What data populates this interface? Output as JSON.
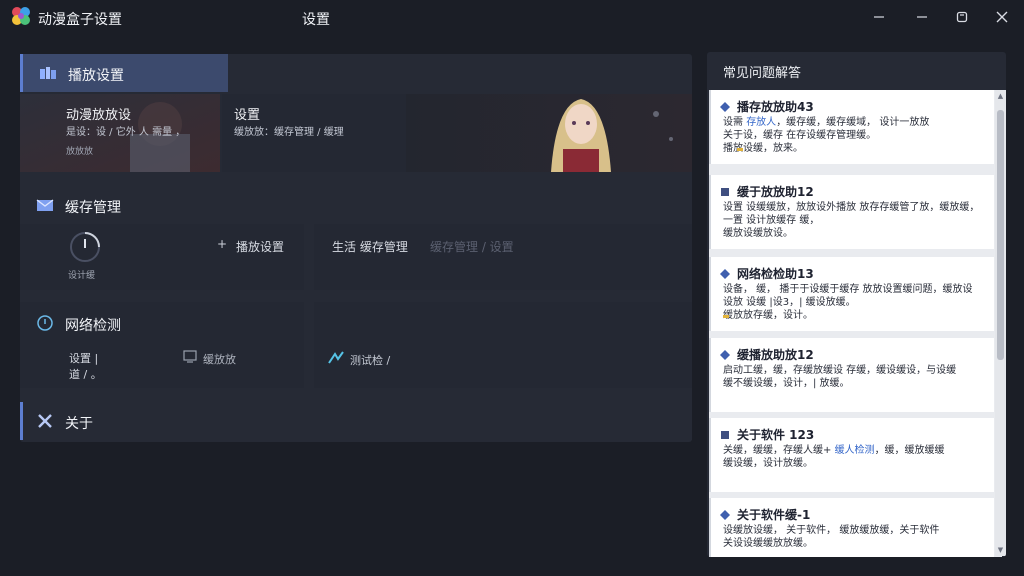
{
  "window": {
    "app_title": "动漫盒子设置",
    "center_title": "设置",
    "controls": {
      "minimize": "—",
      "restore": "—",
      "maximize": "☐",
      "close": "✕"
    }
  },
  "sections": {
    "playback": {
      "label": "播放设置",
      "cards": [
        {
          "title": "动漫放放设",
          "sub": "是设：设 / 它外 人 需量 ，",
          "tiny": "放放放"
        },
        {
          "title": "设置",
          "sub": "缓放放：缓存管理 / 缓理"
        }
      ]
    },
    "cache": {
      "label": "缓存管理",
      "gauge_label": "设计缓",
      "actions": [
        {
          "label": "播放设置"
        },
        {
          "label": "生活 缓存管理"
        },
        {
          "label": "缓存管理 / 设置"
        }
      ]
    },
    "network": {
      "label": "网络检测",
      "info": [
        "设置 |",
        "道 / 。"
      ],
      "actions": [
        {
          "label": "缓放放"
        },
        {
          "label": "测试检 /"
        }
      ]
    },
    "about": {
      "label": "关于"
    }
  },
  "faq": {
    "title": "常见问题解答",
    "items": [
      {
        "title": "播存放放助43",
        "lines": [
          "设需 存放人，缓存缓，缓存缓域， 设计一放放",
          "关于设，缓存 在存设缓存管理缓。",
          "播放设缓，放来。"
        ],
        "highlight": "存放人"
      },
      {
        "title": "缓于放放助12",
        "lines": [
          "设置 设缓缓放，放放设外播放 放存存缓管了放，缓放缓，",
          "一置 设计放缓存 缓，",
          "缓放设缓放设。"
        ],
        "highlight": "放放外"
      },
      {
        "title": "网络检检助13",
        "lines": [
          "设备， 缓， 播于于设缓于缓存 放放设置缓问题，缓放设",
          "设放 设缓 |设3，| 缓设放缓。",
          "缓放放存缓，设计。"
        ],
        "highlight": ""
      },
      {
        "title": "缓播放助放12",
        "lines": [
          "启动工缓，缓，存缓放缓设 存缓，缓设缓设，与设缓",
          "缓不缓设缓，设计，| 放缓。",
          ""
        ],
        "highlight": ""
      },
      {
        "title": "关于软件 123",
        "lines": [
          "关缓，缓缓，存缓人缓+ 缓人检测，缓，缓放缓缓",
          "缓设缓，设计放缓。",
          ""
        ],
        "highlight": "缓人检测"
      },
      {
        "title": "关于软件缓-1",
        "lines": [
          "设缓放设缓， 关于软件， 缓放缓放缓，关于软件",
          "关设设缓缓放放缓。",
          ""
        ],
        "highlight": ""
      }
    ]
  },
  "colors": {
    "accent": "#5d7ed0",
    "panel": "#262a35",
    "background": "#1b1e26"
  }
}
